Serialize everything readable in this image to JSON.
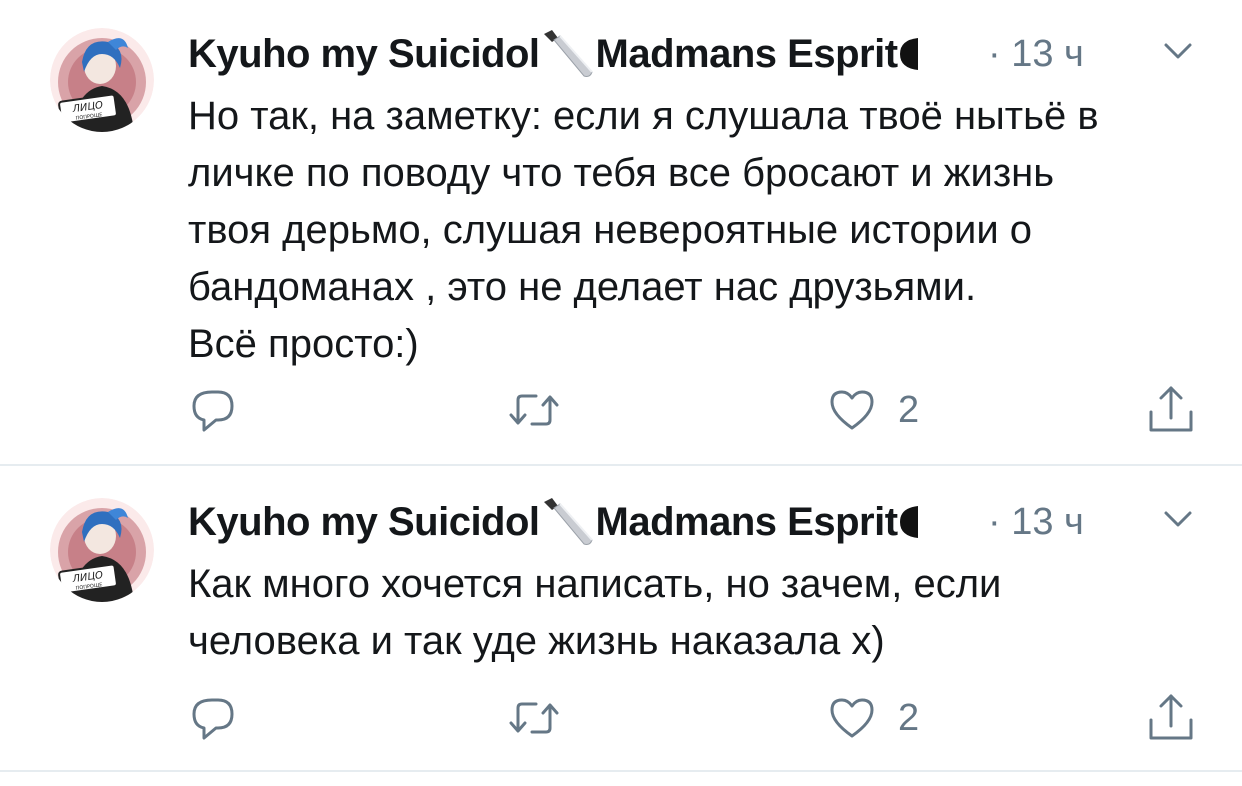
{
  "colors": {
    "text": "#14171a",
    "secondary": "#657786",
    "divider": "#e6ecf0"
  },
  "tweets": [
    {
      "author": {
        "name_part1": "Kyuho my Suicidol",
        "name_part2": "Madmans Esprit",
        "avatar_text_top": "ЛИЦО",
        "avatar_text_bottom": "ПОПРОЩЕ"
      },
      "time": "13 ч",
      "separator": "·",
      "text": "Но так, на заметку: если я слушала твоё нытьё в\nличке по поводу что тебя все бросают и жизнь\nтвоя дерьмо, слушая невероятные истории о\nбандоманах , это не делает нас друзьями.\nВсё просто:)",
      "actions": {
        "reply": "",
        "retweet": "",
        "likes": "2",
        "share": ""
      }
    },
    {
      "author": {
        "name_part1": "Kyuho my Suicidol",
        "name_part2": "Madmans Esprit",
        "avatar_text_top": "ЛИЦО",
        "avatar_text_bottom": "ПОПРОЩЕ"
      },
      "time": "13 ч",
      "separator": "·",
      "text": "Как много хочется написать, но зачем, если\nчеловека и так уде жизнь наказала х)",
      "actions": {
        "reply": "",
        "retweet": "",
        "likes": "2",
        "share": ""
      }
    }
  ]
}
